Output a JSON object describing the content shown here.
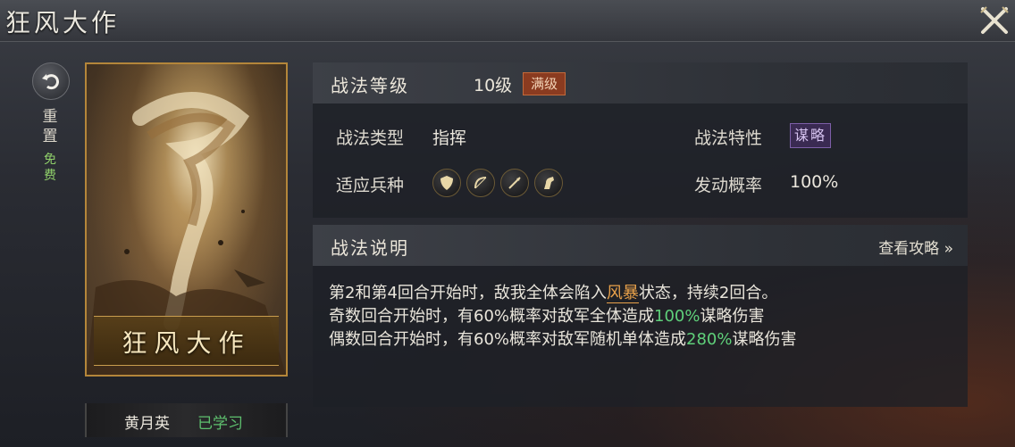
{
  "window": {
    "title": "狂风大作"
  },
  "reset": {
    "label_chars": [
      "重",
      "置"
    ],
    "free_chars": [
      "免",
      "费"
    ]
  },
  "card": {
    "name": "狂风大作"
  },
  "owner": {
    "name": "黄月英",
    "status": "已学习"
  },
  "level_panel": {
    "title": "战法等级",
    "level": "10级",
    "max_badge": "满级",
    "type_label": "战法类型",
    "type_value": "指挥",
    "trait_label": "战法特性",
    "trait_value": "谋略",
    "troops_label": "适应兵种",
    "troop_icons": [
      "shield-icon",
      "bow-icon",
      "spear-icon",
      "horse-icon"
    ],
    "rate_label": "发动概率",
    "rate_value": "100%"
  },
  "desc_panel": {
    "title": "战法说明",
    "guide_link": "查看攻略 »",
    "line1_a": "第2和第4回合开始时，敌我全体会陷入",
    "line1_hl": "风暴",
    "line1_b": "状态，持续2回合。",
    "line2_a": "奇数回合开始时，有60%概率对敌军全体造成",
    "line2_hl": "100%",
    "line2_b": "谋略伤害",
    "line3_a": "偶数回合开始时，有60%概率对敌军随机单体造成",
    "line3_hl": "280%",
    "line3_b": "谋略伤害"
  },
  "colors": {
    "accent_gold": "#b4863a",
    "learned_green": "#5ec06e",
    "max_badge": "#8a3b20",
    "trait_badge": "#3a2a52",
    "highlight_orange": "#e8a14a",
    "highlight_green": "#5fd07a"
  }
}
